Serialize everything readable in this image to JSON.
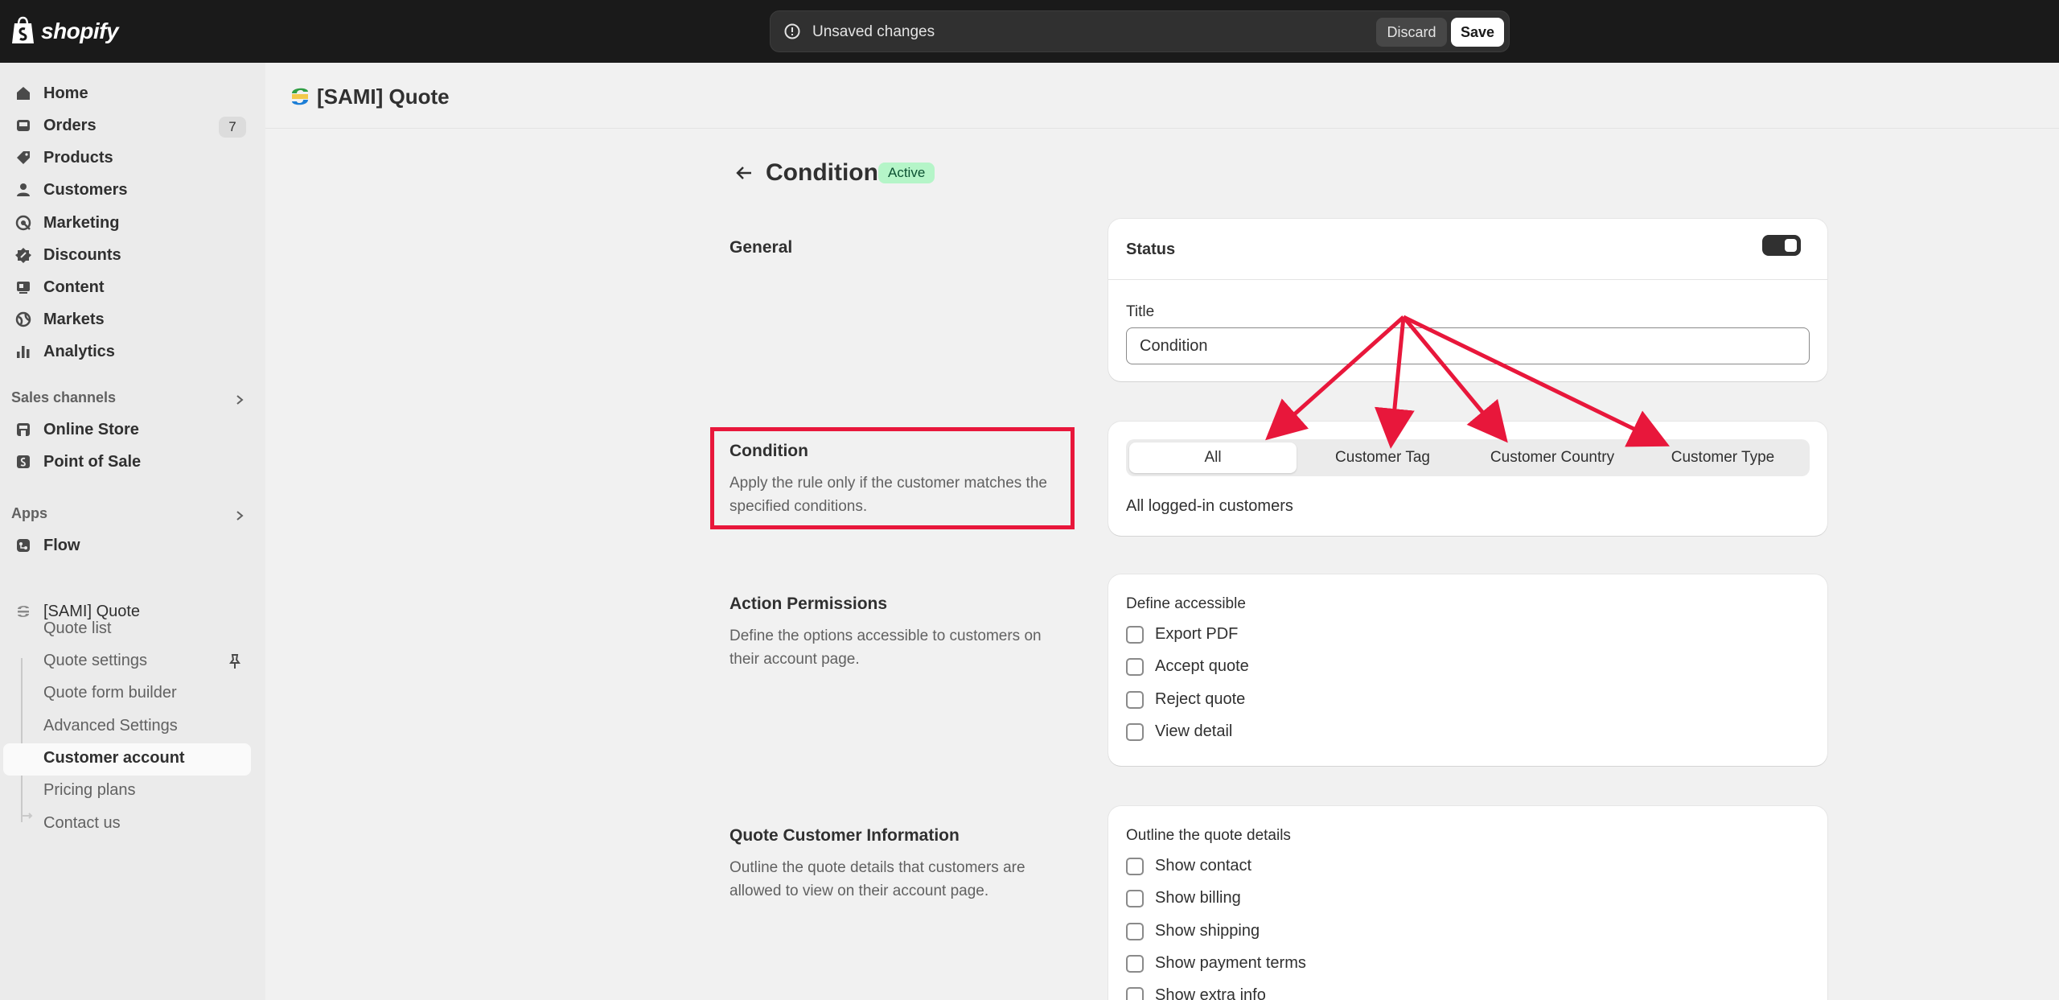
{
  "topbar": {
    "logo_text": "shopify",
    "unsaved_message": "Unsaved changes",
    "discard_label": "Discard",
    "save_label": "Save"
  },
  "sidebar": {
    "items": [
      {
        "label": "Home",
        "icon": "home-icon"
      },
      {
        "label": "Orders",
        "icon": "inbox-icon",
        "count": "7"
      },
      {
        "label": "Products",
        "icon": "tag-icon"
      },
      {
        "label": "Customers",
        "icon": "person-icon"
      },
      {
        "label": "Marketing",
        "icon": "target-icon"
      },
      {
        "label": "Discounts",
        "icon": "discount-icon"
      },
      {
        "label": "Content",
        "icon": "content-icon"
      },
      {
        "label": "Markets",
        "icon": "globe-icon"
      },
      {
        "label": "Analytics",
        "icon": "bar-chart-icon"
      }
    ],
    "sales_channels_label": "Sales channels",
    "sales_channels": [
      {
        "label": "Online Store",
        "icon": "store-icon"
      },
      {
        "label": "Point of Sale",
        "icon": "pos-icon"
      }
    ],
    "apps_label": "Apps",
    "apps": [
      {
        "label": "Flow",
        "icon": "flow-icon"
      }
    ],
    "app_name": "[SAMI] Quote",
    "app_subitems": [
      "Quote list",
      "Quote settings",
      "Quote form builder",
      "Advanced Settings",
      "Customer account",
      "Pricing plans",
      "Contact us"
    ]
  },
  "header": {
    "app_title": "[SAMI] Quote"
  },
  "page": {
    "title": "Condition",
    "status": "Active"
  },
  "general": {
    "title": "General",
    "status_label": "Status",
    "status_enabled": true,
    "title_label": "Title",
    "title_value": "Condition"
  },
  "condition": {
    "title": "Condition",
    "description": "Apply the rule only if the customer matches the specified conditions.",
    "tabs": [
      "All",
      "Customer Tag",
      "Customer Country",
      "Customer Type"
    ],
    "active_tab": "All",
    "tab_content": "All logged-in customers"
  },
  "action_permissions": {
    "title": "Action Permissions",
    "description": "Define the options accessible to customers on their account page.",
    "group_label": "Define accessible",
    "options": [
      "Export PDF",
      "Accept quote",
      "Reject quote",
      "View detail"
    ]
  },
  "quote_customer_info": {
    "title": "Quote Customer Information",
    "description": "Outline the quote details that customers are allowed to view on their account page.",
    "group_label": "Outline the quote details",
    "options": [
      "Show contact",
      "Show billing",
      "Show shipping",
      "Show payment terms",
      "Show extra info"
    ]
  },
  "colors": {
    "annotation_red": "#e8173b",
    "active_badge_bg": "#b5f5c8",
    "topbar_bg": "#1a1a1a"
  }
}
